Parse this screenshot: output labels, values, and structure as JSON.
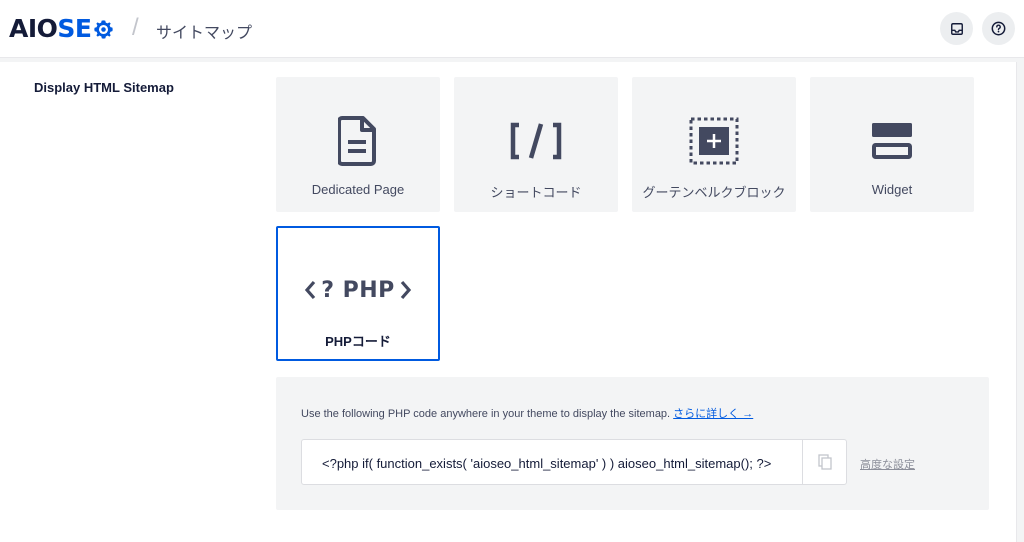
{
  "header": {
    "logo_aio": "AIO",
    "logo_seo": "SE",
    "breadcrumb_separator": "/",
    "page_title": "サイトマップ",
    "brand_color": "#005ae0"
  },
  "setting": {
    "label": "Display HTML Sitemap"
  },
  "options": [
    {
      "label": "Dedicated Page",
      "icon": "document-icon",
      "active": false
    },
    {
      "label": "ショートコード",
      "icon": "shortcode-icon",
      "active": false
    },
    {
      "label": "グーテンベルクブロック",
      "icon": "block-icon",
      "active": false
    },
    {
      "label": "Widget",
      "icon": "widget-icon",
      "active": false
    },
    {
      "label": "PHPコード",
      "icon": "php-icon",
      "active": true
    }
  ],
  "php_icon_text": "<? PHP",
  "code": {
    "description": "Use the following PHP code anywhere in your theme to display the sitemap.",
    "learn_more": "さらに詳しく →",
    "snippet": "<?php if( function_exists( 'aioseo_html_sitemap' ) ) aioseo_html_sitemap(); ?>",
    "advanced_link": "高度な設定"
  }
}
